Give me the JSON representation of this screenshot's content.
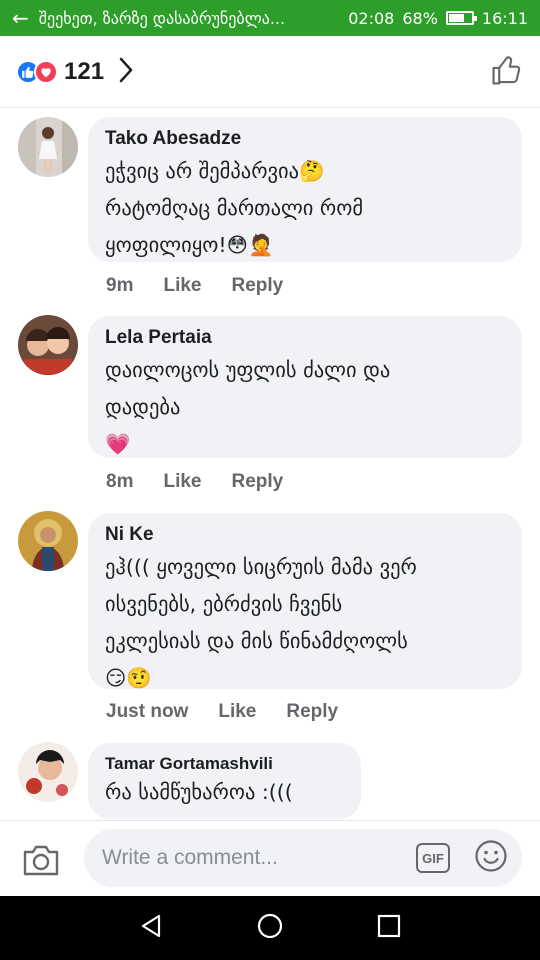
{
  "status_bar": {
    "return_text": "შეეხეთ, ზარზე დასაბრუნებლა...",
    "call_timer": "02:08",
    "battery_percent": "68%",
    "battery_level": 0.68,
    "clock": "16:11",
    "back_icon": "arrow-left-icon",
    "accent": "#2e9e2a"
  },
  "reactions": {
    "count": "121",
    "icons": [
      "like-icon",
      "love-icon"
    ],
    "like_color": "#1877f2",
    "love_color": "#f33e58"
  },
  "comments": [
    {
      "author": "Tako Abesadze",
      "text": "ეჭვიც არ შემპარვია🤔\nრატომღაც მართალი რომ\nყოფილიყო!😳🤦",
      "time": "9m",
      "like_label": "Like",
      "reply_label": "Reply"
    },
    {
      "author": "Lela Pertaia",
      "text": "დაილოცოს უფლის ძალი  და\nდადება\n💗",
      "time": "8m",
      "like_label": "Like",
      "reply_label": "Reply"
    },
    {
      "author": "Ni Ke",
      "text": "ეჰ((( ყოველი სიცრუის მამა ვერ\nისვენებს, ებრძვის ჩვენს\nეკლესიას და მის წინამძღოლს\n😏🤨",
      "time": "Just now",
      "like_label": "Like",
      "reply_label": "Reply"
    },
    {
      "author": "Tamar Gortamashvili",
      "text": "რა სამწუხაროა :(((",
      "time": "",
      "like_label": "",
      "reply_label": ""
    }
  ],
  "composer": {
    "placeholder": "Write a comment...",
    "gif_label": "GIF"
  }
}
